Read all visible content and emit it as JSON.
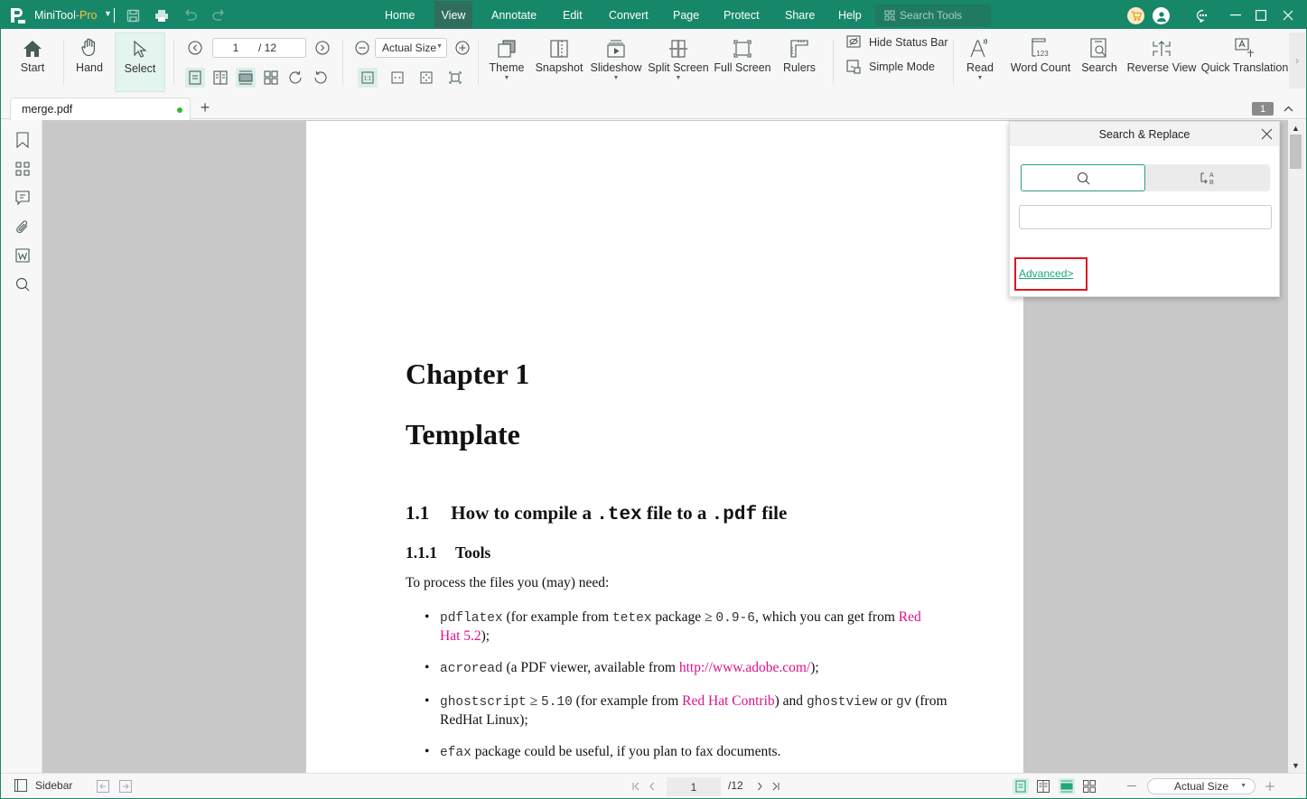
{
  "titlebar": {
    "app_name": "MiniTool",
    "app_suffix": "-Pro",
    "menus": [
      "Home",
      "View",
      "Annotate",
      "Edit",
      "Convert",
      "Page",
      "Protect",
      "Share",
      "Help"
    ],
    "active_menu": "View",
    "search_placeholder": "Search Tools",
    "icons": [
      "save-icon",
      "print-icon",
      "undo-icon",
      "redo-icon",
      "cart-icon",
      "account-icon",
      "feedback-icon",
      "minimize-icon",
      "maximize-icon",
      "close-icon"
    ]
  },
  "ribbon": {
    "start": "Start",
    "hand": "Hand",
    "select": "Select",
    "page_current": "1",
    "page_total": "/ 12",
    "zoom_value": "Actual Size",
    "theme": "Theme",
    "snapshot": "Snapshot",
    "slideshow": "Slideshow",
    "split_screen": "Split Screen",
    "full_screen": "Full Screen",
    "rulers": "Rulers",
    "hide_status_bar": "Hide Status Bar",
    "simple_mode": "Simple Mode",
    "read": "Read",
    "word_count": "Word Count",
    "search": "Search",
    "reverse_view": "Reverse View",
    "quick_translation": "Quick Translation"
  },
  "tabs": {
    "doc_tab": "merge.pdf",
    "page_badge": "1"
  },
  "document": {
    "chapter": "Chapter 1",
    "title": "Template",
    "section_num": "1.1",
    "section_pre": "How to compile a ",
    "section_tex": ".tex",
    "section_mid": " file to a ",
    "section_pdf": ".pdf",
    "section_post": " file",
    "subsection_num": "1.1.1",
    "subsection_title": "Tools",
    "intro": "To process the files you (may) need:",
    "bullets": [
      {
        "m1": "pdflatex",
        "t1": " (for example from ",
        "m2": "tetex",
        "t2": " package ≥ ",
        "m3": "0.9-6",
        "t3": ", which you can get from ",
        "link": "Red Hat 5.2",
        "t4": ");"
      },
      {
        "m1": "acroread",
        "t1": " (a PDF viewer, available from ",
        "link": "http://www.adobe.com/",
        "t2": ");"
      },
      {
        "m1": "ghostscript",
        "t1": " ≥ ",
        "m2": "5.10",
        "t2": " (for example from ",
        "link": "Red Hat Contrib",
        "t3": ") and ",
        "m3": "ghostview",
        "t4": " or ",
        "m4": "gv",
        "t5": " (from RedHat Linux);"
      },
      {
        "m1": "efax",
        "t1": " package could be useful, if you plan to fax documents."
      }
    ]
  },
  "search_panel": {
    "title": "Search & Replace",
    "search_value": "",
    "advanced_link": "Advanced>"
  },
  "statusbar": {
    "sidebar_label": "Sidebar",
    "page_current": "1",
    "page_total": "/12",
    "zoom_value": "Actual Size"
  },
  "colors": {
    "brand_green": "#17876a",
    "accent_green": "#27a37d",
    "link_magenta": "#e0108a",
    "highlight_red": "#e0141e",
    "pro_yellow": "#f5c542"
  }
}
